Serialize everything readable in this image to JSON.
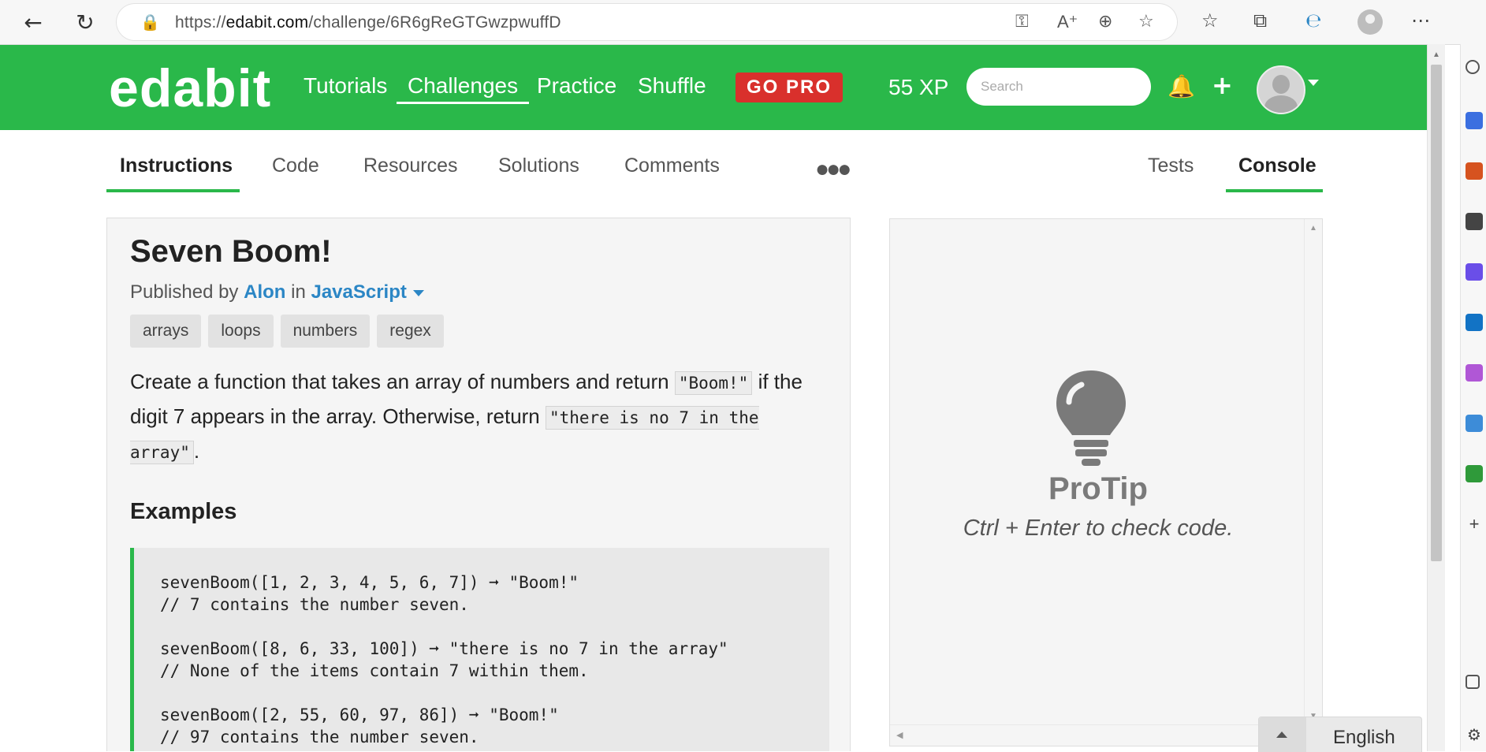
{
  "browser": {
    "url_prefix": "https://",
    "url_host": "edabit.com",
    "url_path": "/challenge/6R6gReGTGwzpwuffD",
    "back_icon": "arrow-left-icon",
    "refresh_icon": "refresh-icon"
  },
  "header": {
    "logo": "edabit",
    "nav": [
      "Tutorials",
      "Challenges",
      "Practice",
      "Shuffle"
    ],
    "go_pro": "GO PRO",
    "xp": "55 XP",
    "search_placeholder": "Search"
  },
  "tabs": {
    "left": [
      "Instructions",
      "Code",
      "Resources",
      "Solutions",
      "Comments"
    ],
    "right": [
      "Tests",
      "Console"
    ],
    "active_left": "Instructions",
    "active_right": "Console"
  },
  "challenge": {
    "title": "Seven Boom!",
    "published_by": "Published by",
    "author": "Alon",
    "in": "in",
    "language": "JavaScript",
    "tags": [
      "arrays",
      "loops",
      "numbers",
      "regex"
    ],
    "desc_1": "Create a function that takes an array of numbers and return ",
    "code_1": "\"Boom!\"",
    "desc_2": " if the digit 7 appears in the array. Otherwise, return ",
    "code_2": "\"there is no 7 in the array\"",
    "desc_3": ".",
    "examples_heading": "Examples",
    "examples": [
      "sevenBoom([1, 2, 3, 4, 5, 6, 7]) ➞ \"Boom!\"",
      "// 7 contains the number seven.",
      "",
      "sevenBoom([8, 6, 33, 100]) ➞ \"there is no 7 in the array\"",
      "// None of the items contain 7 within them.",
      "",
      "sevenBoom([2, 55, 60, 97, 86]) ➞ \"Boom!\"",
      "// 97 contains the number seven."
    ]
  },
  "console": {
    "protip_title": "ProTip",
    "protip_text": "Ctrl + Enter to check code."
  },
  "language_selector": {
    "label": "English"
  },
  "colors": {
    "brand_green": "#2ab84a",
    "go_pro_red": "#d9302c",
    "link_blue": "#2b86c5"
  }
}
